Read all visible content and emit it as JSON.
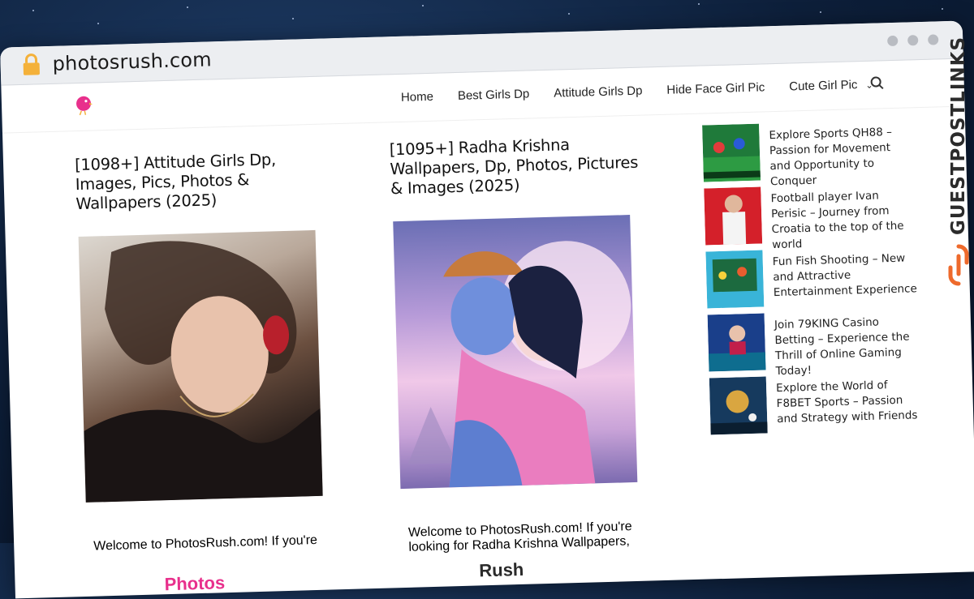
{
  "browser": {
    "url": "photosrush.com"
  },
  "site": {
    "logo_part1": "Photos",
    "logo_part2": "Rush",
    "nav": [
      "Home",
      "Best Girls Dp",
      "Attitude Girls Dp",
      "Hide Face Girl Pic",
      "Cute Girl Pic"
    ]
  },
  "posts": [
    {
      "title": "[1098+] Attitude Girls Dp, Images, Pics, Photos & Wallpapers (2025)",
      "excerpt": "Welcome to PhotosRush.com! If you're"
    },
    {
      "title": "[1095+] Radha Krishna Wallpapers, Dp, Photos, Pictures & Images (2025)",
      "excerpt": "Welcome to PhotosRush.com! If you're looking for Radha Krishna Wallpapers,"
    }
  ],
  "sidebar": [
    {
      "title": "Explore Sports QH88 – Passion for Movement and Opportunity to Conquer"
    },
    {
      "title": "Football player Ivan Perisic – Journey from Croatia to the top of the world"
    },
    {
      "title": "Fun Fish Shooting – New and Attractive Entertainment Experience"
    },
    {
      "title": "Join 79KING Casino Betting – Experience the Thrill of Online Gaming Today!"
    },
    {
      "title": "Explore the World of F8BET Sports – Passion and Strategy with Friends"
    }
  ],
  "watermark": "GUESTPOSTLINKS",
  "colors": {
    "brand_pink": "#e8308c",
    "accent_orange": "#ee6a2c"
  }
}
